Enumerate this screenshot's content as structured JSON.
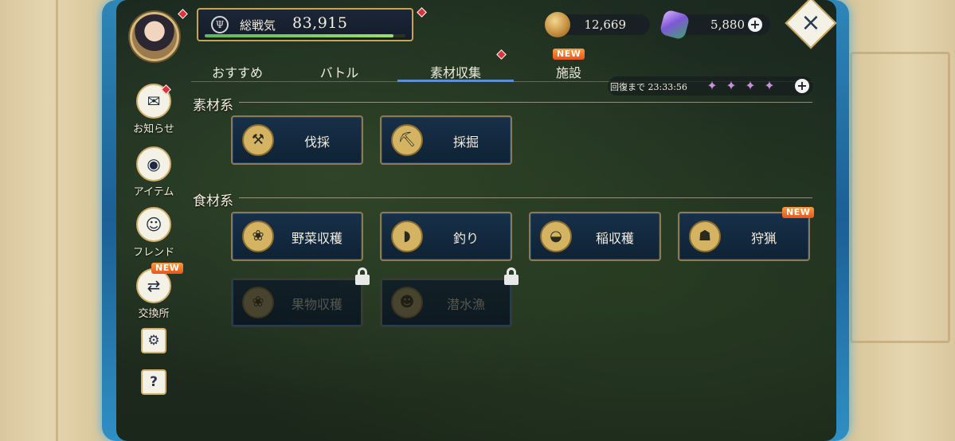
{
  "player": {
    "power_label": "総戦気",
    "power_value": "83,915",
    "power_fill": 0.94
  },
  "currencies": {
    "coins": "12,669",
    "gems": "5,880",
    "add_symbol": "+"
  },
  "close_symbol": "×",
  "side_menu": {
    "news": "お知らせ",
    "items": "アイテム",
    "friends": "フレンド",
    "exchange": "交換所",
    "help_symbol": "?"
  },
  "new_badge": "NEW",
  "tabs": [
    {
      "label": "おすすめ"
    },
    {
      "label": "バトル"
    },
    {
      "label": "素材収集",
      "active": true
    },
    {
      "label": "施設"
    }
  ],
  "recovery": {
    "text": "回復まで 23:33:56",
    "stamina_icons": 4
  },
  "sections": {
    "materials": {
      "title": "素材系",
      "buttons": [
        {
          "label": "伐採",
          "icon": "axe-icon"
        },
        {
          "label": "採掘",
          "icon": "pickaxe-icon"
        }
      ]
    },
    "food": {
      "title": "食材系",
      "buttons": [
        {
          "label": "野菜収穫",
          "icon": "vegetable-icon"
        },
        {
          "label": "釣り",
          "icon": "fish-icon"
        },
        {
          "label": "稲収穫",
          "icon": "rice-icon"
        },
        {
          "label": "狩猟",
          "icon": "beast-icon"
        },
        {
          "label": "果物収穫",
          "icon": "fruit-icon",
          "locked": true
        },
        {
          "label": "潜水漁",
          "icon": "diving-icon",
          "locked": true
        }
      ]
    }
  }
}
